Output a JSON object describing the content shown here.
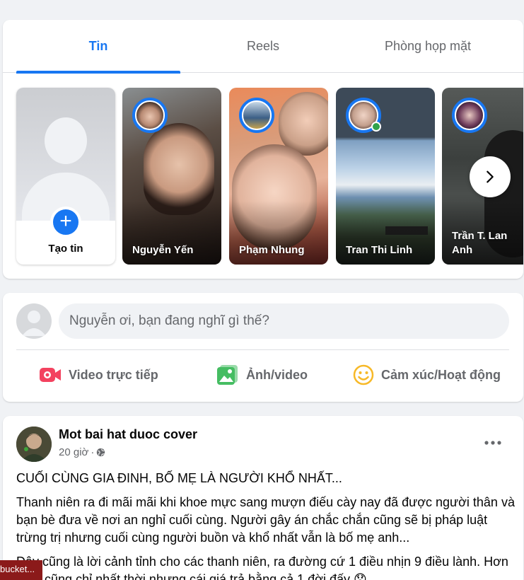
{
  "tabs": [
    {
      "label": "Tin",
      "active": true
    },
    {
      "label": "Reels",
      "active": false
    },
    {
      "label": "Phòng họp mặt",
      "active": false
    }
  ],
  "stories": {
    "create_label": "Tạo tin",
    "items": [
      {
        "name": "Nguyễn Yến",
        "online": false
      },
      {
        "name": "Phạm Nhung",
        "online": false
      },
      {
        "name": "Tran Thi Linh",
        "online": true
      },
      {
        "name": "Trần T. Lan Anh",
        "online": false
      }
    ],
    "next_icon": "chevron-right-icon"
  },
  "composer": {
    "placeholder": "Nguyễn ơi, bạn đang nghĩ gì thế?",
    "actions": [
      {
        "label": "Video trực tiếp",
        "icon": "live-video-icon",
        "color": "#f3425f"
      },
      {
        "label": "Ảnh/video",
        "icon": "photo-icon",
        "color": "#45bd62"
      },
      {
        "label": "Cảm xúc/Hoạt động",
        "icon": "feeling-icon",
        "color": "#f7b928"
      }
    ]
  },
  "post": {
    "author": "Mot bai hat duoc cover",
    "time": "20 giờ",
    "privacy_icon": "globe-icon",
    "paragraphs": [
      "CUỐI CÙNG GIA ĐINH, BỐ MẸ LÀ NGƯỜI KHỔ NHẤT...",
      "Thanh niên ra đi mãi mãi khi khoe mực sang mượn điếu cày nay đã được người thân và bạn bè đưa về nơi an nghỉ cuối cùng. Người gây án chắc chắn cũng sẽ bị pháp luật trừng trị nhưng cuối cùng người buồn và khổ nhất vẫn là bố mẹ anh...",
      "Đây cũng là lời cảnh tỉnh cho các thanh niên, ra đường cứ 1 điều nhịn 9 điều lành. Hơn thua cũng chỉ nhất thời nhưng cái giá trả bằng cả 1 đời đấy 😞"
    ]
  },
  "toast": {
    "label": "bucket..."
  },
  "colors": {
    "accent": "#1877f2",
    "background": "#f0f2f5",
    "secondary_text": "#65676b"
  }
}
